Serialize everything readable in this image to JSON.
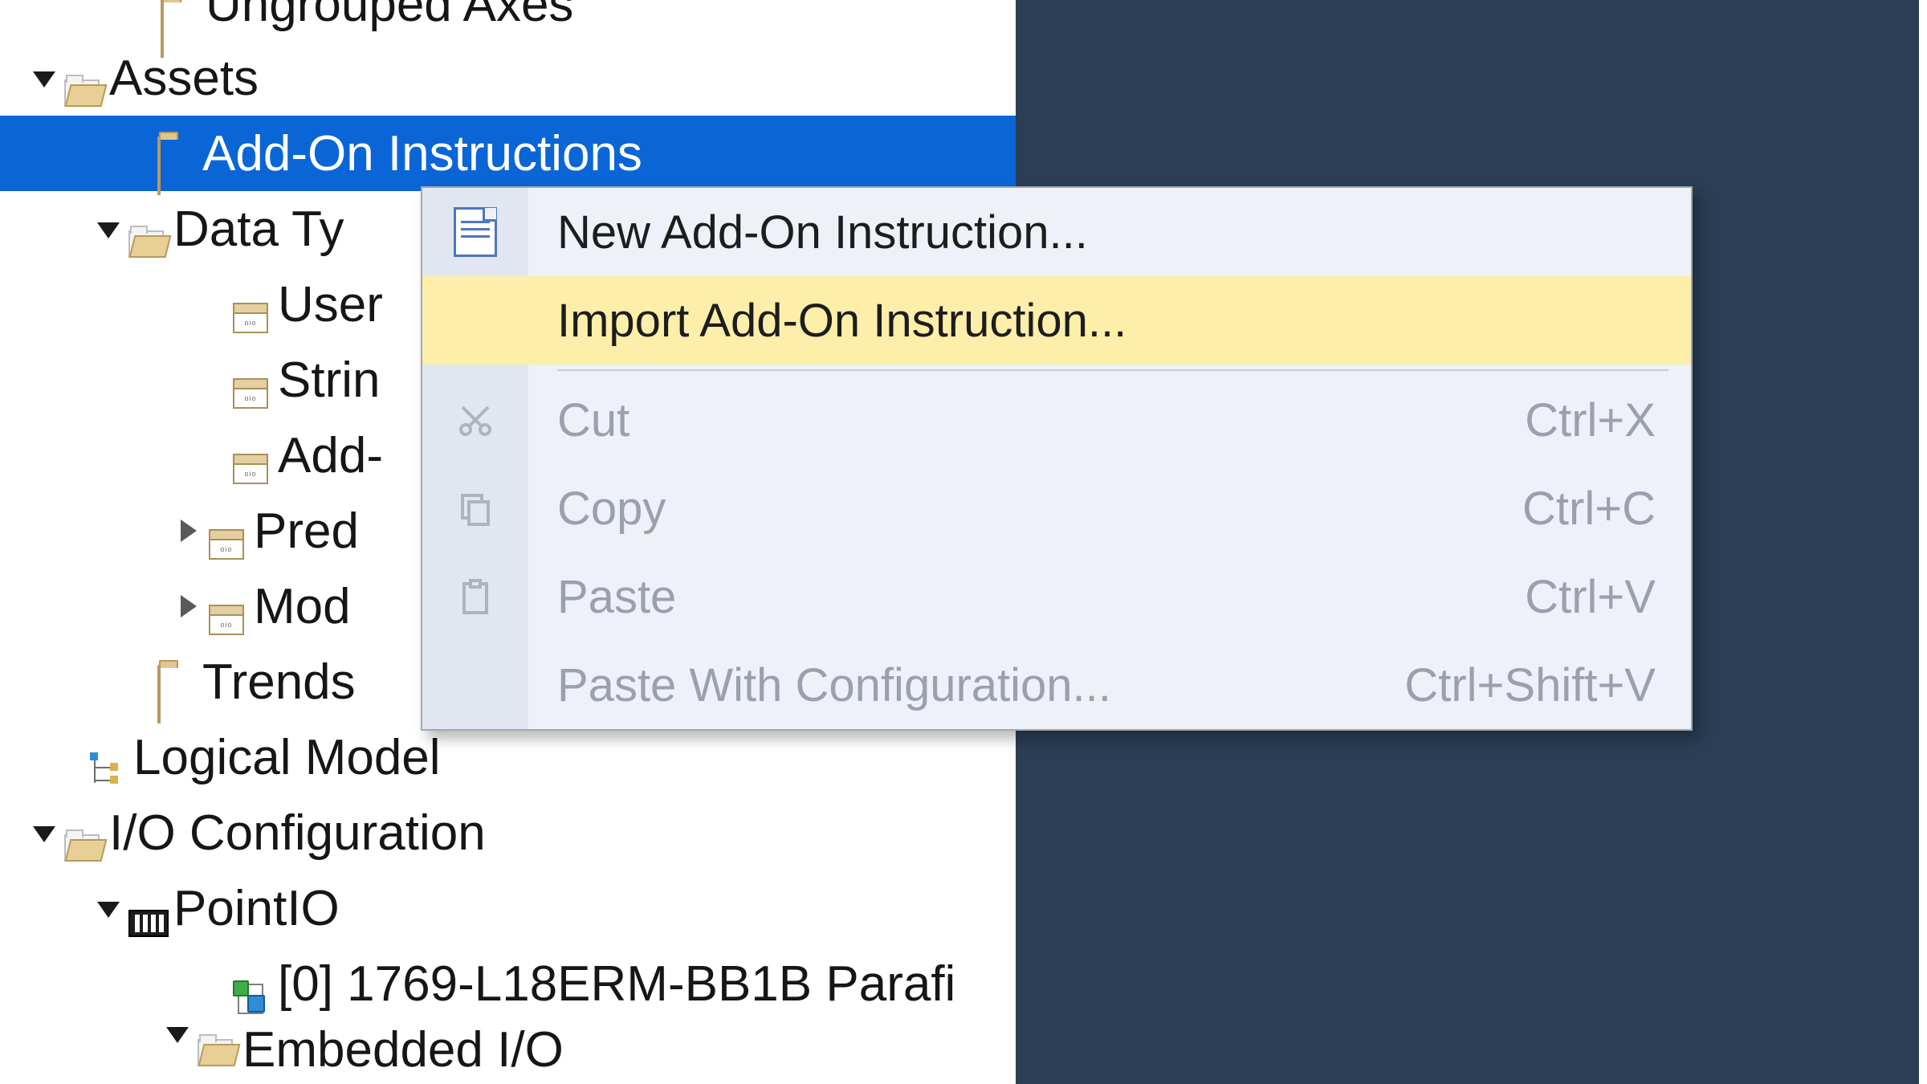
{
  "tree": {
    "ungrouped_axes": "Ungrouped Axes",
    "assets": "Assets",
    "add_on_instructions": "Add-On Instructions",
    "data_types": "Data Ty",
    "user_defined": "User",
    "strings": "Strin",
    "addon_defined": "Add-",
    "predefined": "Pred",
    "module_defined": "Mod",
    "trends": "Trends",
    "logical_model": "Logical Model",
    "io_configuration": "I/O Configuration",
    "pointio": "PointIO",
    "controller_module": "[0] 1769-L18ERM-BB1B Parafi",
    "embedded_io": "Embedded I/O"
  },
  "context_menu": {
    "new_add_on": "New Add-On Instruction...",
    "import_add_on": "Import Add-On Instruction...",
    "cut": "Cut",
    "cut_shortcut": "Ctrl+X",
    "copy": "Copy",
    "copy_shortcut": "Ctrl+C",
    "paste": "Paste",
    "paste_shortcut": "Ctrl+V",
    "paste_with_config": "Paste With Configuration...",
    "paste_with_config_shortcut": "Ctrl+Shift+V"
  },
  "colors": {
    "selection": "#0a66d6",
    "hover": "#fdeea9",
    "panel_bg": "#2b3e55"
  }
}
